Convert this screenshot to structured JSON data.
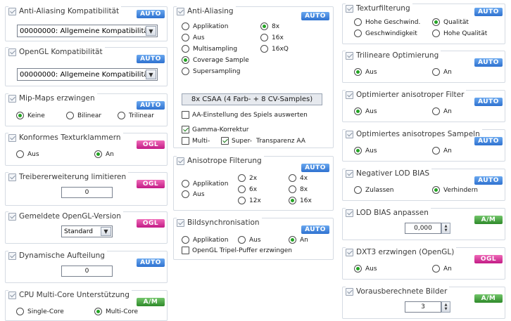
{
  "badges": {
    "auto": "AUTO",
    "ogl": "OGL",
    "am": "A/M"
  },
  "left": {
    "aa_compat": {
      "title": "Anti-Aliasing Kompatibilität",
      "value": "00000000: Allgemeine Kompatibilität"
    },
    "ogl_compat": {
      "title": "OpenGL Kompatibilität",
      "value": "00000000: Allgemeine Kompatibilität"
    },
    "mipmaps": {
      "title": "Mip-Maps erzwingen",
      "options": [
        "Keine",
        "Bilinear",
        "Trilinear"
      ],
      "selected": "Keine"
    },
    "clamp": {
      "title": "Konformes Texturklammern",
      "options": [
        "Aus",
        "An"
      ],
      "selected": "An"
    },
    "ext_limit": {
      "title": "Treibererweiterung limitieren",
      "value": "0"
    },
    "ogl_version": {
      "title": "Gemeldete OpenGL-Version",
      "value": "Standard"
    },
    "dyn_split": {
      "title": "Dynamische Aufteilung",
      "value": "0"
    },
    "multicore": {
      "title": "CPU Multi-Core Unterstützung",
      "options": [
        "Single-Core",
        "Multi-Core"
      ],
      "selected": "Multi-Core"
    }
  },
  "middle": {
    "aa": {
      "title": "Anti-Aliasing",
      "mode_options": [
        "Applikation",
        "Aus",
        "Multisampling",
        "Coverage Sample",
        "Supersampling"
      ],
      "mode_selected": "Coverage Sample",
      "level_options": [
        "8x",
        "16x",
        "16xQ"
      ],
      "level_selected": "8x",
      "csaa_label": "8x CSAA (4 Farb- + 8 CV-Samples)",
      "game_setting_label": "AA-Einstellung des Spiels auswerten",
      "gamma_label": "Gamma-Korrektur",
      "multi_label": "Multi-",
      "super_label": "Super-",
      "transparency_label": "Transparenz AA"
    },
    "aniso": {
      "title": "Anisotrope Filterung",
      "mode_options": [
        "Applikation",
        "Aus"
      ],
      "level_options": [
        "2x",
        "4x",
        "6x",
        "8x",
        "12x",
        "16x"
      ],
      "level_selected": "16x"
    },
    "vsync": {
      "title": "Bildsynchronisation",
      "options": [
        "Applikation",
        "Aus",
        "An"
      ],
      "selected": "An",
      "triple_label": "OpenGL Tripel-Puffer erzwingen"
    }
  },
  "right": {
    "texfilter": {
      "title": "Texturfilterung",
      "options": [
        "Hohe Geschwind.",
        "Qualität",
        "Geschwindigkeit",
        "Hohe Qualität"
      ],
      "selected": "Qualität"
    },
    "trilinear": {
      "title": "Trilineare Optimierung",
      "options": [
        "Aus",
        "An"
      ],
      "selected": "Aus"
    },
    "aniso_filter": {
      "title": "Optimierter anisotroper Filter",
      "options": [
        "Aus",
        "An"
      ],
      "selected": "Aus"
    },
    "aniso_sample": {
      "title": "Optimiertes anisotropes Sampeln",
      "options": [
        "Aus",
        "An"
      ],
      "selected": "Aus"
    },
    "neg_lod": {
      "title": "Negativer LOD BIAS",
      "options": [
        "Zulassen",
        "Verhindern"
      ],
      "selected": "Verhindern"
    },
    "lod_bias": {
      "title": "LOD BIAS anpassen",
      "value": "0,000"
    },
    "dxt3": {
      "title": "DXT3 erzwingen (OpenGL)",
      "options": [
        "Aus",
        "An"
      ],
      "selected": "Aus"
    },
    "prerender": {
      "title": "Vorausberechnete Bilder",
      "value": "3"
    }
  }
}
